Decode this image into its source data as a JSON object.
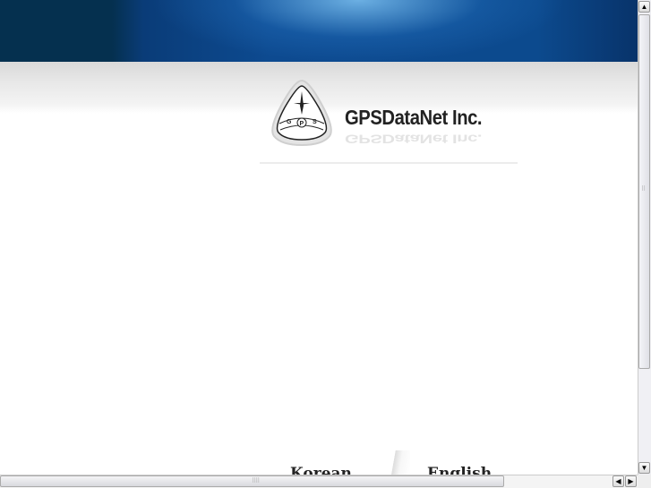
{
  "brand": {
    "name": "GPSDataNet Inc.",
    "logo_letters": "GPS"
  },
  "languages": [
    {
      "label": "Korean"
    },
    {
      "label": "English"
    }
  ],
  "scrollbars": {
    "vertical_position": 0.0,
    "horizontal_position": 0.0
  },
  "colors": {
    "header": "#05304f",
    "ocean": "#0d4a90"
  }
}
